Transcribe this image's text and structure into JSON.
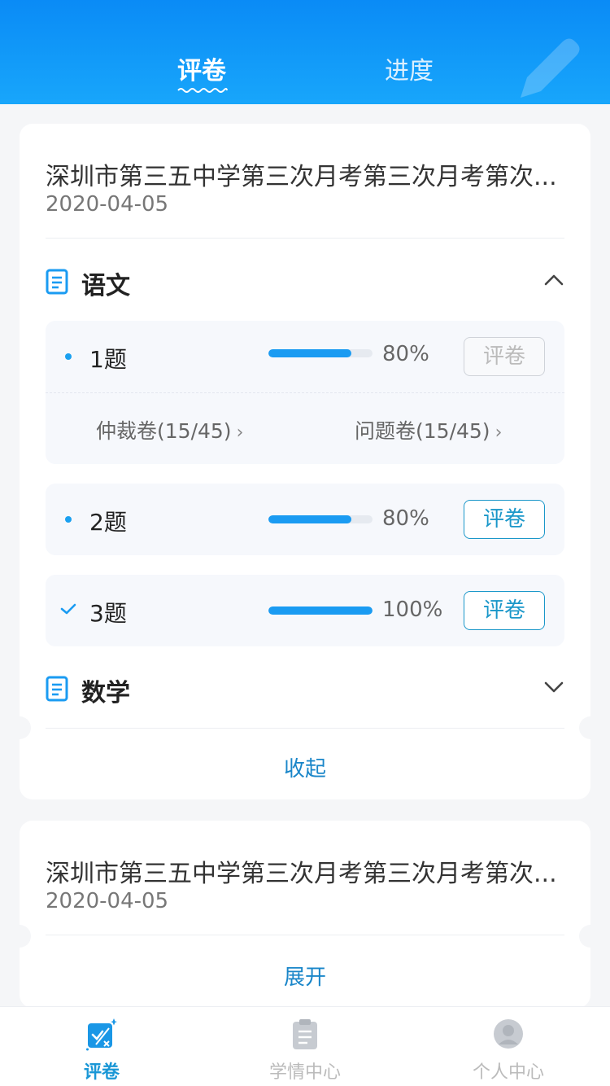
{
  "header": {
    "tabs": [
      {
        "label": "评卷",
        "active": true
      },
      {
        "label": "进度",
        "active": false
      }
    ]
  },
  "cards": [
    {
      "title": "深圳市第三五中学第三次月考第三次月考第次...",
      "date": "2020-04-05",
      "subjects": [
        {
          "name": "语文",
          "expanded": true,
          "questions": [
            {
              "label": "1题",
              "progress_percent": 80,
              "progress_text": "80%",
              "button": "评卷",
              "button_enabled": false,
              "status": "dot",
              "links": [
                {
                  "label": "仲裁卷(15/45)",
                  "arrow": "›"
                },
                {
                  "label": "问题卷(15/45)",
                  "arrow": "›"
                }
              ]
            },
            {
              "label": "2题",
              "progress_percent": 80,
              "progress_text": "80%",
              "button": "评卷",
              "button_enabled": true,
              "status": "dot"
            },
            {
              "label": "3题",
              "progress_percent": 100,
              "progress_text": "100%",
              "button": "评卷",
              "button_enabled": true,
              "status": "check"
            }
          ]
        },
        {
          "name": "数学",
          "expanded": false
        }
      ],
      "toggle": "收起"
    },
    {
      "title": "深圳市第三五中学第三次月考第三次月考第次...",
      "date": "2020-04-05",
      "toggle": "展开"
    }
  ],
  "bottom_nav": [
    {
      "label": "评卷",
      "icon": "grading-icon",
      "active": true
    },
    {
      "label": "学情中心",
      "icon": "clipboard-icon",
      "active": false
    },
    {
      "label": "个人中心",
      "icon": "user-icon",
      "active": false
    }
  ],
  "colors": {
    "header_blue": "#0a8bf6",
    "accent": "#1a97c9",
    "progress": "#1a9bf2"
  }
}
